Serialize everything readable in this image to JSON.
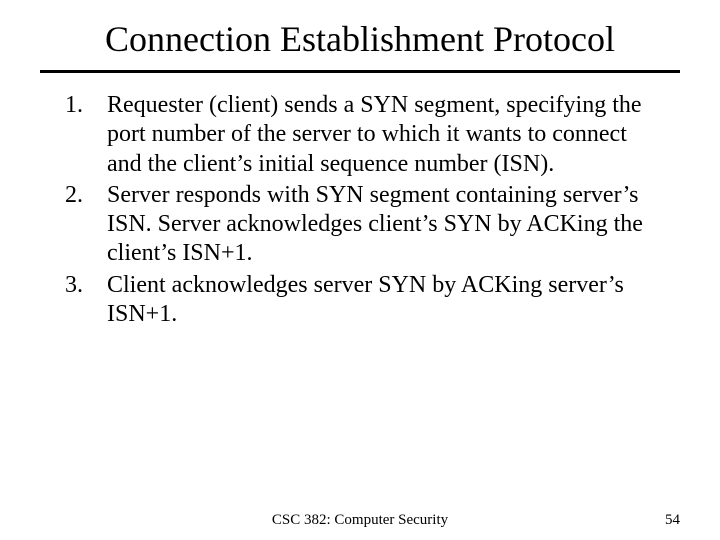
{
  "title": "Connection Establishment Protocol",
  "items": [
    {
      "num": "1.",
      "text": "Requester (client) sends a SYN segment, specifying the port number of the server to which it wants to connect and the client’s initial sequence number (ISN)."
    },
    {
      "num": "2.",
      "text": "Server responds with SYN segment containing server’s ISN.  Server acknowledges client’s SYN by ACKing the client’s ISN+1."
    },
    {
      "num": "3.",
      "text": "Client acknowledges server SYN by ACKing server’s ISN+1."
    }
  ],
  "footer": {
    "center": "CSC 382: Computer Security",
    "right": "54"
  }
}
